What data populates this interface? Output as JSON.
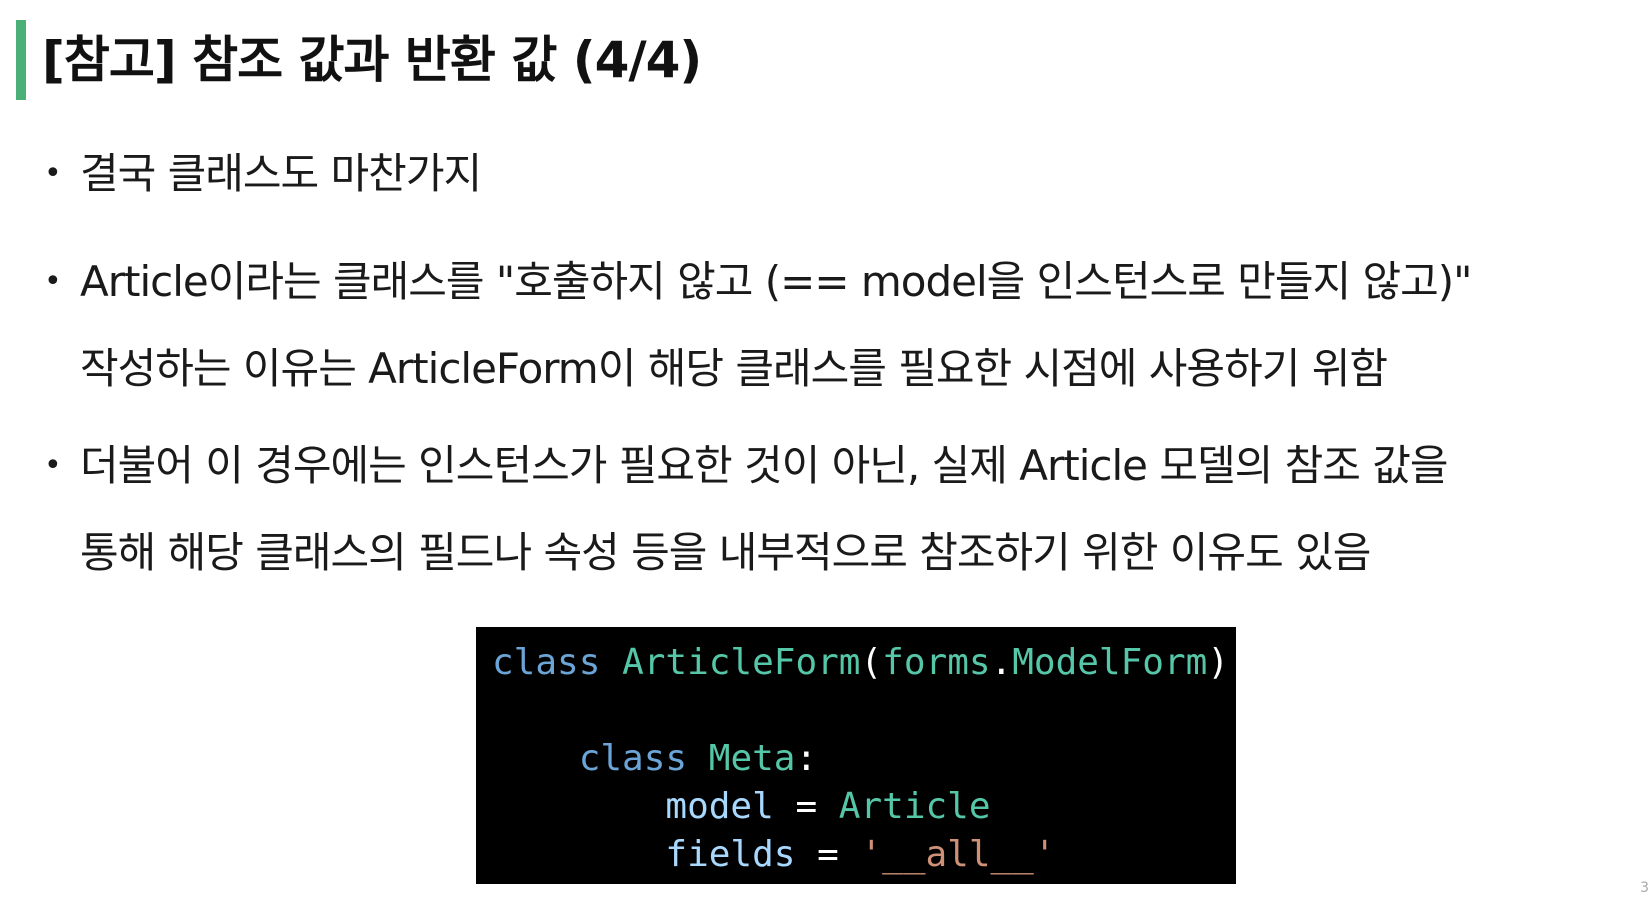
{
  "title": "[참고] 참조 값과 반환 값 (4/4)",
  "bullets": [
    {
      "lines": [
        "결국 클래스도 마찬가지"
      ]
    },
    {
      "lines": [
        "Article이라는 클래스를 \"호출하지 않고 (== model을 인스턴스로 만들지 않고)\"",
        "작성하는 이유는 ArticleForm이 해당 클래스를 필요한 시점에 사용하기 위함"
      ]
    },
    {
      "lines": [
        "더불어 이 경우에는 인스턴스가 필요한 것이 아닌, 실제 Article 모델의 참조 값을",
        "통해 해당 클래스의 필드나 속성 등을 내부적으로 참조하기 위한 이유도 있음"
      ]
    }
  ],
  "code": {
    "line1": {
      "kw": "class",
      "name": "ArticleForm",
      "open": "(",
      "module": "forms",
      "dot": ".",
      "base": "ModelForm",
      "close": "):"
    },
    "line3": {
      "indent": "    ",
      "kw": "class",
      "name": "Meta",
      "colon": ":"
    },
    "line4": {
      "indent": "        ",
      "var": "model",
      "op": " = ",
      "value": "Article"
    },
    "line5": {
      "indent": "        ",
      "var": "fields",
      "op": " = ",
      "value": "'__all__'"
    }
  },
  "page_number": "3",
  "colors": {
    "accent": "#4caf78",
    "code_bg": "#000000",
    "keyword": "#6ba4d6",
    "class_name": "#55c7a8",
    "variable": "#a9d8ff",
    "string": "#ce9178"
  }
}
